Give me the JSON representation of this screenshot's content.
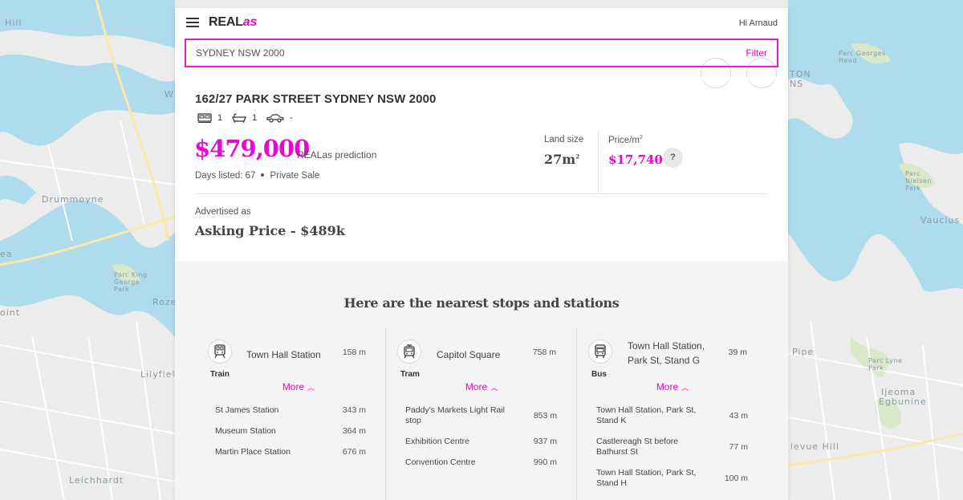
{
  "header": {
    "logo_main": "REAL",
    "logo_accent": "as",
    "greeting": "Hi Arnaud"
  },
  "search": {
    "value": "SYDNEY NSW 2000",
    "filter_label": "Filter"
  },
  "property": {
    "address": "162/27 PARK STREET SYDNEY NSW 2000",
    "bedrooms": "1",
    "bathrooms": "1",
    "parking": "-",
    "price": "$479,000",
    "price_caption": "REALas prediction",
    "days_listed": "Days listed: 67",
    "sale_type": "Private Sale",
    "land_size_label": "Land size",
    "land_size_value": "27m",
    "land_size_sup": "2",
    "price_per_m2_label": "Price/m",
    "price_per_m2_sup": "2",
    "price_per_m2_value": "$17,740",
    "help_label": "?",
    "advertised_label": "Advertised as",
    "advertised_value": "Asking Price - $489k"
  },
  "stops": {
    "title": "Here are the nearest stops and stations",
    "more_label": "More",
    "columns": [
      {
        "mode": "Train",
        "name": "Town Hall Station",
        "distance": "158 m",
        "items": [
          {
            "name": "St James Station",
            "distance": "343 m"
          },
          {
            "name": "Museum Station",
            "distance": "364 m"
          },
          {
            "name": "Martin Place Station",
            "distance": "676 m"
          }
        ]
      },
      {
        "mode": "Tram",
        "name": "Capitol Square",
        "distance": "758 m",
        "items": [
          {
            "name": "Paddy's Markets Light Rail stop",
            "distance": "853 m"
          },
          {
            "name": "Exhibition Centre",
            "distance": "937 m"
          },
          {
            "name": "Convention Centre",
            "distance": "990 m"
          }
        ]
      },
      {
        "mode": "Bus",
        "name": "Town Hall Station, Park St, Stand G",
        "distance": "39 m",
        "items": [
          {
            "name": "Town Hall Station, Park St, Stand K",
            "distance": "43 m"
          },
          {
            "name": "Castlereagh St before Bathurst St",
            "distance": "77 m"
          },
          {
            "name": "Town Hall Station, Park St, Stand H",
            "distance": "100 m"
          }
        ]
      }
    ]
  },
  "map_labels": {
    "drummoyne": "Drummoyne",
    "leichhardt": "Leichhardt",
    "lilyfield": "Lilyfiel",
    "roze": "Roze",
    "vaucluse": "Vauclus",
    "piper": "Pipe",
    "ijeoma": "Ijeoma",
    "egbunine": "Egbunine",
    "bellevue": "levue Hill",
    "hill": "Hill",
    "ea": "ea",
    "oint": "oint",
    "ton": "TON",
    "ns": "NS",
    "wh": "W",
    "parc_georges": "Parc Georges Head",
    "parc_nielsen": "Parc Nielsen Park",
    "parc_king": "Parc King George Park",
    "parc_lyne": "Parc Lyne Park"
  },
  "colors": {
    "accent": "#e60ad1",
    "water": "#aedcec",
    "land": "#f2f2f2"
  }
}
